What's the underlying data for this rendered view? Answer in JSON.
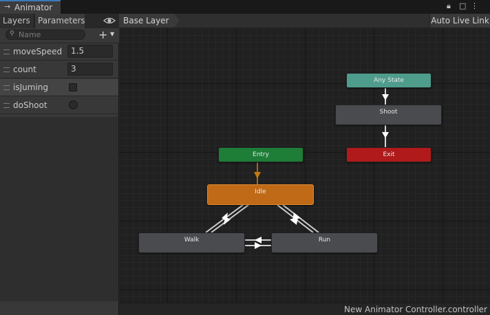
{
  "window": {
    "title": "Animator"
  },
  "left_panel": {
    "tabs": [
      {
        "label": "Layers"
      },
      {
        "label": "Parameters"
      }
    ],
    "search": {
      "placeholder": "Name"
    },
    "parameters": [
      {
        "name": "moveSpeed",
        "type": "float",
        "value": "1.5"
      },
      {
        "name": "count",
        "type": "int",
        "value": "3"
      },
      {
        "name": "isJuming",
        "type": "bool",
        "checked": false
      },
      {
        "name": "doShoot",
        "type": "trigger",
        "set": false
      }
    ]
  },
  "graph": {
    "breadcrumb": "Base Layer",
    "auto_live_link": "Auto Live Link",
    "states": {
      "any_state": "Any State",
      "shoot": "Shoot",
      "exit": "Exit",
      "entry": "Entry",
      "idle": "Idle",
      "walk": "Walk",
      "run": "Run"
    }
  },
  "footer": {
    "file": "New Animator Controller.controller"
  },
  "colors": {
    "entry": "#1e7d37",
    "any_state": "#4e9d8c",
    "exit": "#b01a1a",
    "default_state": "#c06a17",
    "state": "#4a4b4e",
    "tab_accent": "#3a79bb"
  }
}
